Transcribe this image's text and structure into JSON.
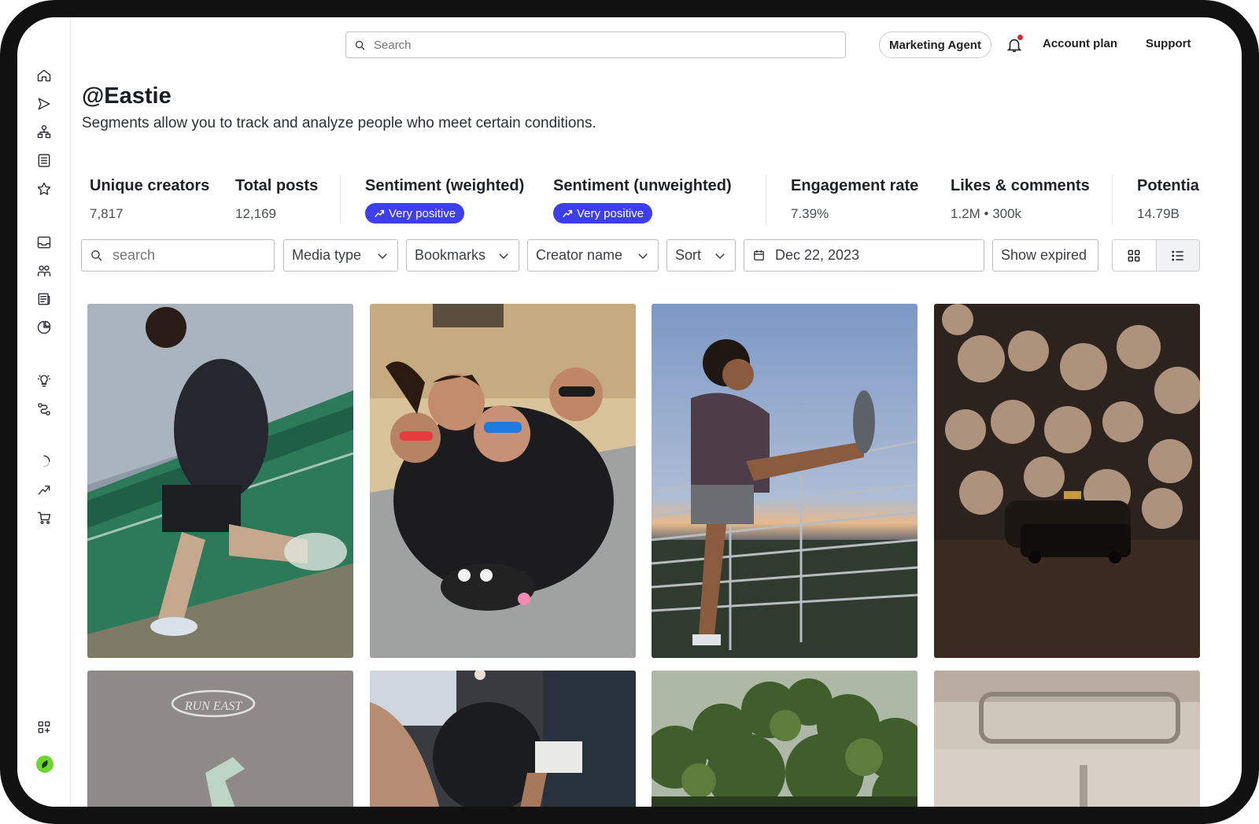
{
  "topbar": {
    "search_placeholder": "Search",
    "agent_label": "Marketing Agent",
    "account_label": "Account plan",
    "support_label": "Support"
  },
  "header": {
    "title": "@Eastie",
    "subtitle": "Segments allow you to track and analyze people who meet certain conditions."
  },
  "stats": {
    "unique_creators": {
      "label": "Unique creators",
      "value": "7,817"
    },
    "total_posts": {
      "label": "Total posts",
      "value": "12,169"
    },
    "sentiment_weighted": {
      "label": "Sentiment (weighted)",
      "value": "Very positive"
    },
    "sentiment_unweighted": {
      "label": "Sentiment (unweighted)",
      "value": "Very positive"
    },
    "engagement_rate": {
      "label": "Engagement rate",
      "value": "7.39%"
    },
    "likes_comments": {
      "label": "Likes & comments",
      "value": "1.2M • 300k"
    },
    "potential": {
      "label": "Potentia",
      "value": "14.79B"
    }
  },
  "filters": {
    "search_placeholder": "search",
    "media_type": "Media type",
    "bookmarks": "Bookmarks",
    "creator_name": "Creator name",
    "sort": "Sort",
    "date": "Dec 22, 2023",
    "show_expired": "Show expired"
  },
  "colors": {
    "accent": "#3c3ef0",
    "notification": "#e0253b",
    "brand_avatar": "#6fd62f"
  },
  "tiles_row1": [
    "runner-on-bridge",
    "group-of-friends-sunglasses",
    "man-stretching-on-railing",
    "toy-taxi-bokeh"
  ],
  "tiles_row2": [
    "run-east-shirt",
    "runners-motion-blur",
    "green-hillside-trees",
    "car-interior"
  ],
  "tile_text": {
    "shirt_logo": "RUN EAST"
  }
}
